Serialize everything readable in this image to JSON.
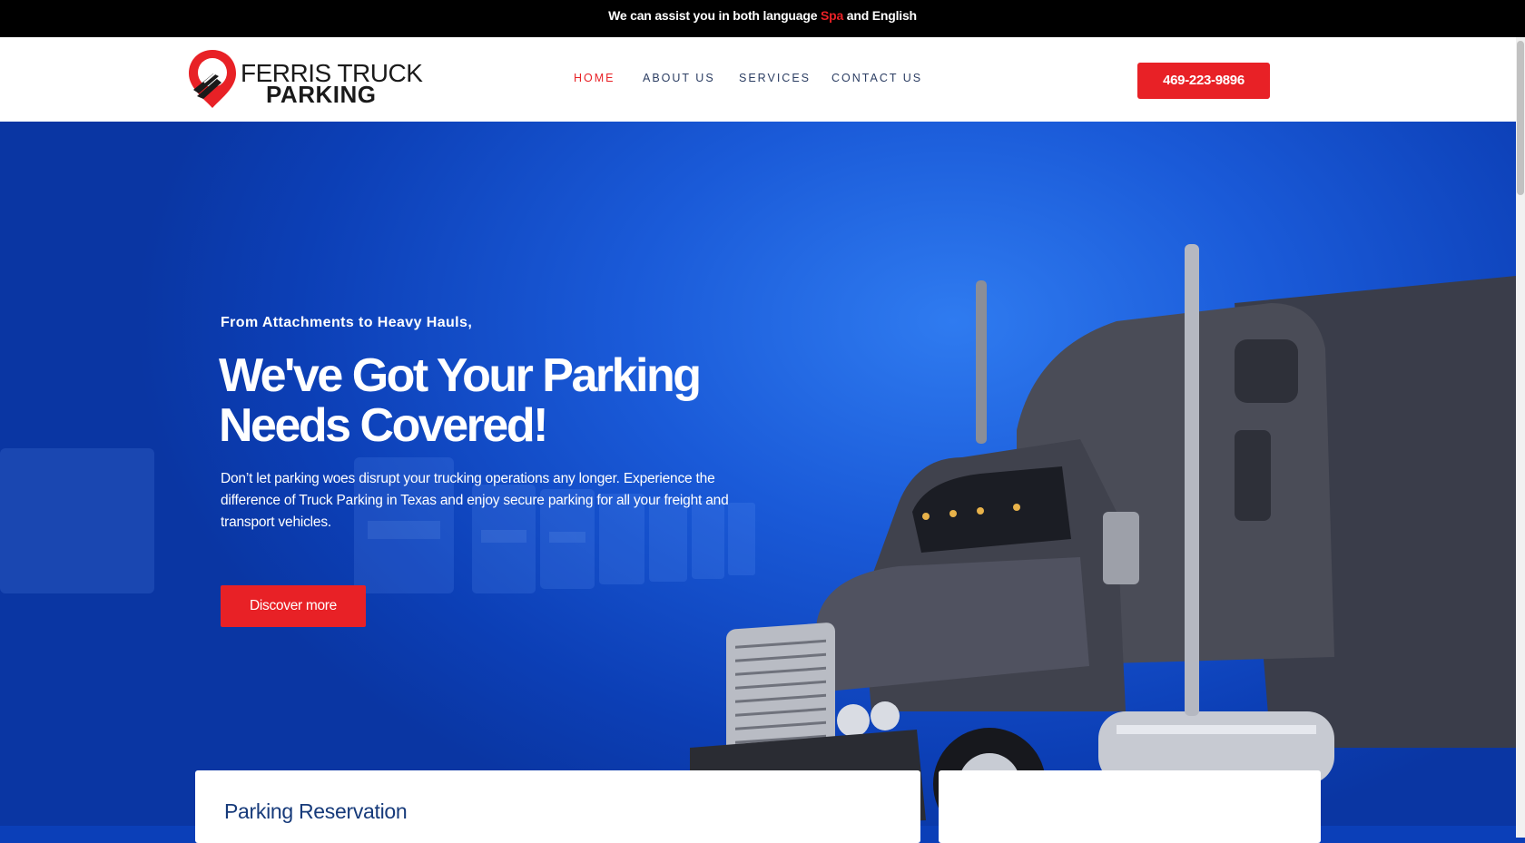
{
  "topbar": {
    "before": "We can assist you in both language ",
    "accent_word": "Spa",
    "after": " and English"
  },
  "header": {
    "logo": {
      "line1": "FERRIS TRUCK",
      "line2": "PARKING"
    },
    "nav": [
      {
        "label": "HOME",
        "active": true
      },
      {
        "label": "ABOUT US",
        "active": false
      },
      {
        "label": "SERVICES",
        "active": false
      },
      {
        "label": "CONTACT US",
        "active": false
      }
    ],
    "phone_label": "469-223-9896"
  },
  "hero": {
    "subtitle": "From Attachments to Heavy Hauls,",
    "title_line1": "We've Got Your Parking",
    "title_line2": "Needs Covered!",
    "description": "Don’t let parking woes disrupt your trucking operations any longer. Experience the difference of Truck Parking in Texas and enjoy secure parking for all your freight and transport vehicles.",
    "cta_label": "Discover more"
  },
  "cards": {
    "reservation_title": "Parking Reservation"
  },
  "colors": {
    "accent": "#e82126",
    "nav_text": "#2c3e63",
    "hero_blue": "#1a5ad8",
    "card_title": "#163a7a"
  },
  "icons": [
    "map-pin-road-icon",
    "truck-illustration"
  ]
}
